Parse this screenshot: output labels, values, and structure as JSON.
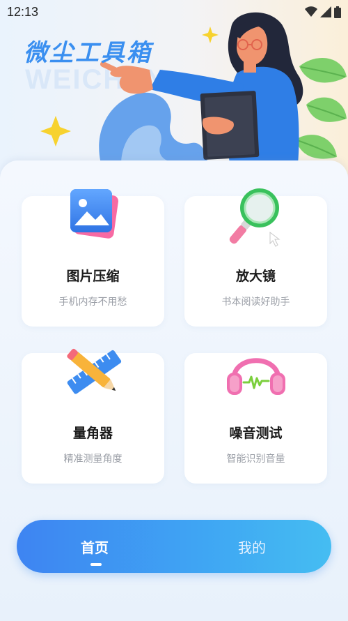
{
  "status_bar": {
    "time": "12:13"
  },
  "hero": {
    "title": "微尘工具箱",
    "watermark": "WEICHEN"
  },
  "tools": [
    {
      "title": "图片压缩",
      "subtitle": "手机内存不用愁",
      "icon": "image-icon"
    },
    {
      "title": "放大镜",
      "subtitle": "书本阅读好助手",
      "icon": "magnifier-icon"
    },
    {
      "title": "量角器",
      "subtitle": "精准测量角度",
      "icon": "ruler-pencil-icon"
    },
    {
      "title": "噪音测试",
      "subtitle": "智能识别音量",
      "icon": "headphones-icon"
    }
  ],
  "bottom_nav": {
    "items": [
      {
        "label": "首页",
        "active": true
      },
      {
        "label": "我的",
        "active": false
      }
    ]
  },
  "colors": {
    "accent": "#3a8ff0",
    "nav_gradient_start": "#3e84f2",
    "nav_gradient_end": "#45bdf2"
  }
}
